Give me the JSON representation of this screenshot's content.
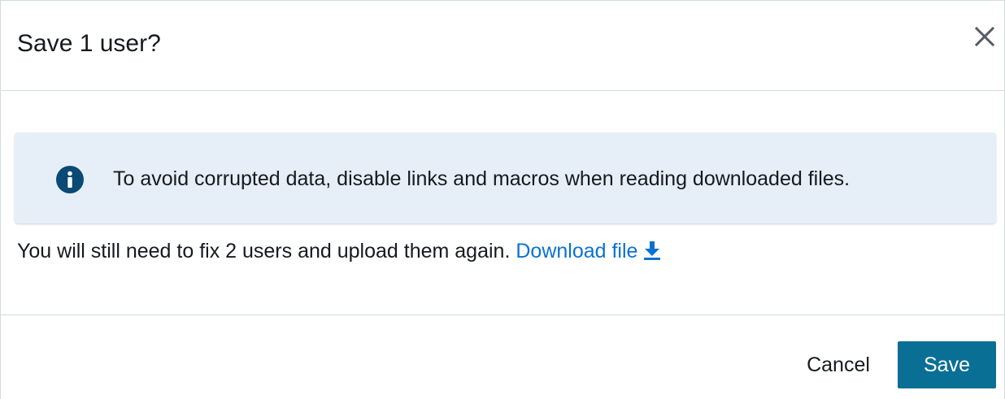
{
  "dialog": {
    "title": "Save 1 user?",
    "close_icon": "close-icon"
  },
  "alert": {
    "icon": "info-icon",
    "message": "To avoid corrupted data, disable links and macros when reading downloaded files."
  },
  "body": {
    "message": "You will still need to fix 2 users and upload them again.",
    "download_label": "Download file",
    "download_icon": "download-icon"
  },
  "footer": {
    "cancel_label": "Cancel",
    "save_label": "Save"
  },
  "colors": {
    "alert_background": "#e6eff8",
    "info_icon": "#0a4a74",
    "link": "#0972d3",
    "primary_button": "#0a6f95",
    "text": "#16191f",
    "divider": "#d5dbdb"
  }
}
